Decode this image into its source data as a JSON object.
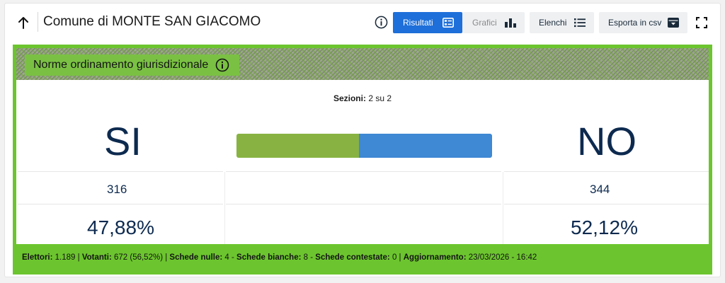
{
  "header": {
    "title": "Comune di MONTE SAN GIACOMO",
    "tabs": [
      {
        "label": "Risultati",
        "icon": "list-card-icon",
        "active": true
      },
      {
        "label": "Grafici",
        "icon": "bar-chart-icon",
        "active": false
      },
      {
        "label": "Elenchi",
        "icon": "list-icon",
        "active": false
      },
      {
        "label": "Esporta in csv",
        "icon": "download-box-icon",
        "active": false
      }
    ]
  },
  "referendum": {
    "title": "Norme ordinamento giurisdizionale",
    "sezioni_label": "Sezioni:",
    "sezioni_value": "2 su 2",
    "si": {
      "label": "SI",
      "votes": "316",
      "percent": "47,88%",
      "color": "#88b342"
    },
    "no": {
      "label": "NO",
      "votes": "344",
      "percent": "52,12%",
      "color": "#3e88d4"
    },
    "bar_fraction_si": 0.4788
  },
  "footer": {
    "elettori_label": "Elettori:",
    "elettori": "1.189",
    "votanti_label": "Votanti:",
    "votanti": "672 (56,52%)",
    "nulle_label": "Schede nulle:",
    "nulle": "4",
    "bianche_label": "Schede bianche:",
    "bianche": "8",
    "contestate_label": "Schede contestate:",
    "contestate": "0",
    "aggiornamento_label": "Aggiornamento:",
    "aggiornamento": "23/03/2026 - 16:42"
  },
  "colors": {
    "accent": "#1e6fd9",
    "panel_green": "#6cc52e",
    "text_dark_blue": "#0d2a4f"
  }
}
